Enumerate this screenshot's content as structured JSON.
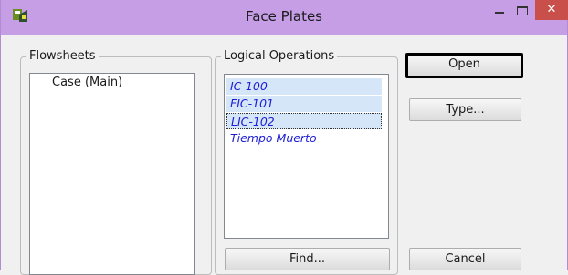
{
  "window": {
    "title": "Face Plates",
    "close_label": "✕",
    "app_icon": "aspen-app-icon",
    "accent": "#c69ee6"
  },
  "flowsheets": {
    "label": "Flowsheets",
    "items": [
      "Case (Main)"
    ]
  },
  "logical_operations": {
    "label": "Logical Operations",
    "items": [
      "IC-100",
      "FIC-101",
      "LIC-102",
      "Tiempo Muerto"
    ],
    "item_color": "#1d1dd4"
  },
  "buttons": {
    "open": "Open",
    "type": "Type...",
    "find": "Find...",
    "cancel": "Cancel"
  }
}
